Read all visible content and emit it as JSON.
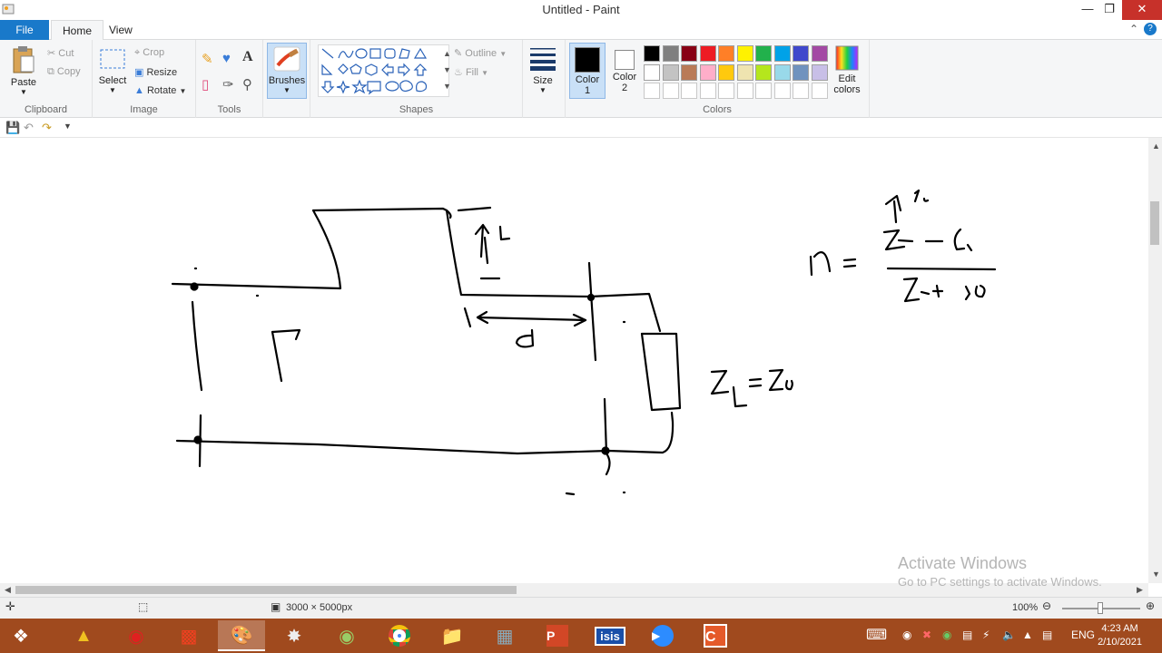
{
  "window": {
    "title": "Untitled - Paint",
    "minimize_icon": "minimize-icon",
    "maximize_icon": "restore-icon",
    "close_icon": "close-icon"
  },
  "tabs": {
    "file": "File",
    "home": "Home",
    "view": "View"
  },
  "ribbon": {
    "clipboard": {
      "label": "Clipboard",
      "paste": "Paste",
      "cut": "Cut",
      "copy": "Copy"
    },
    "image": {
      "label": "Image",
      "select": "Select",
      "crop": "Crop",
      "resize": "Resize",
      "rotate": "Rotate"
    },
    "tools": {
      "label": "Tools"
    },
    "brushes": {
      "label": "Brushes"
    },
    "shapes": {
      "label": "Shapes",
      "outline": "Outline",
      "fill": "Fill"
    },
    "size": {
      "label": "Size"
    },
    "colors": {
      "label": "Colors",
      "color1_line1": "Color",
      "color1_line2": "1",
      "color2_line1": "Color",
      "color2_line2": "2",
      "edit_line1": "Edit",
      "edit_line2": "colors",
      "color1": "#000000",
      "color2": "#ffffff",
      "palette_row1": [
        "#000000",
        "#7f7f7f",
        "#880015",
        "#ed1c24",
        "#ff7f27",
        "#fff200",
        "#22b14c",
        "#00a2e8",
        "#3f48cc",
        "#a349a4"
      ],
      "palette_row2": [
        "#ffffff",
        "#c3c3c3",
        "#b97a57",
        "#ffaec9",
        "#ffc90e",
        "#efe4b0",
        "#b5e61d",
        "#99d9ea",
        "#7092be",
        "#c8bfe7"
      ]
    }
  },
  "status": {
    "dimensions": "3000 × 5000px",
    "zoom": "100%"
  },
  "watermark": {
    "line1": "Activate Windows",
    "line2": "Go to PC settings to activate Windows."
  },
  "taskbar": {
    "time": "4:23 AM",
    "date": "2/10/2021",
    "lang": "ENG",
    "isis_label": "isis"
  }
}
